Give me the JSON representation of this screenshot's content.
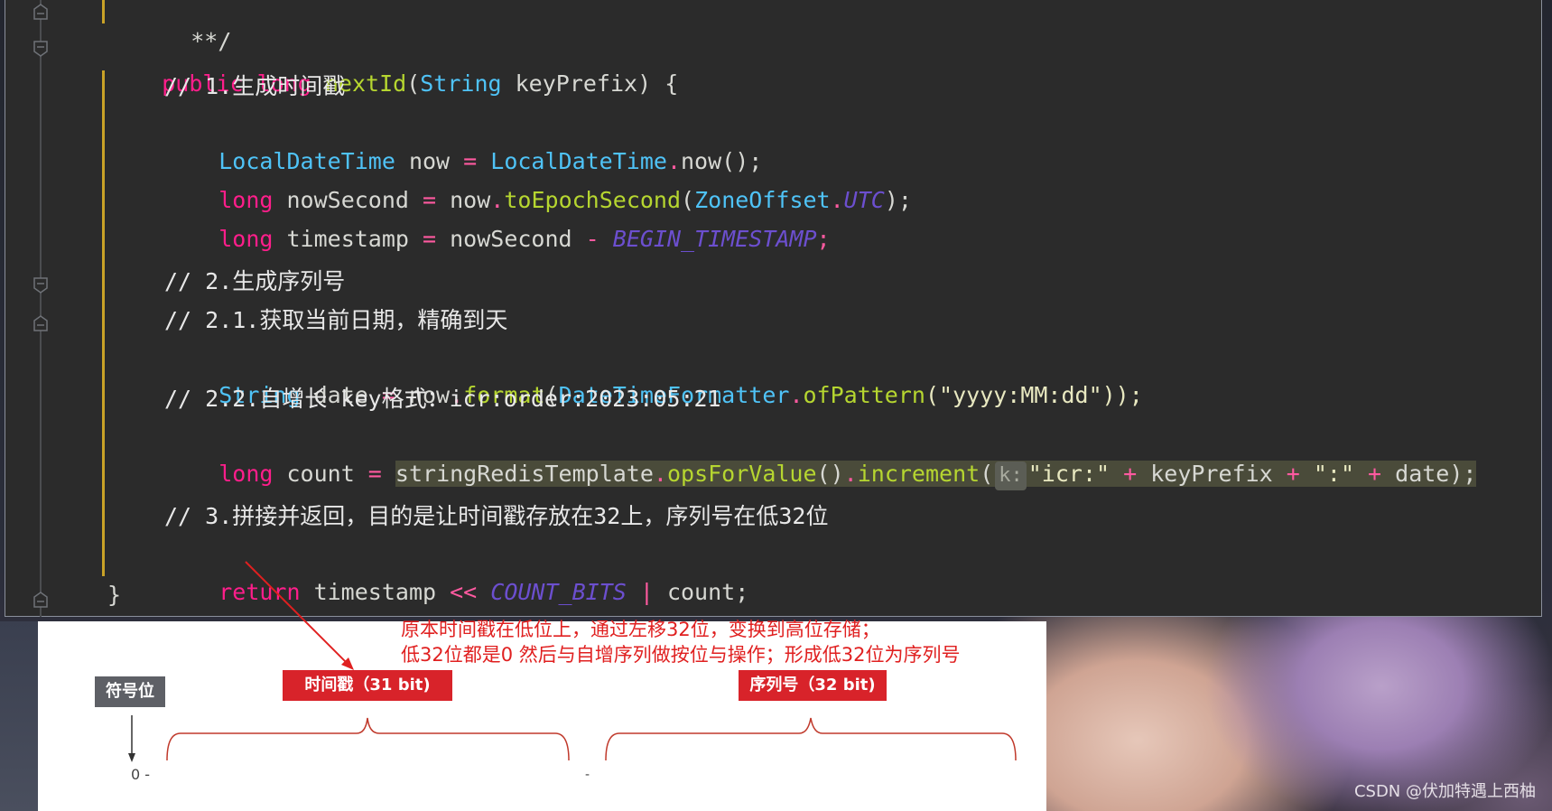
{
  "code": {
    "top_comment": "**/",
    "method_signature": {
      "kw_public": "public",
      "kw_long": "long",
      "name": "nextId",
      "paren_open": "(",
      "param_type": "String",
      "param_name": "keyPrefix",
      "paren_close": ") {"
    },
    "comment_1": "// 1.生成时间戳",
    "line_now": {
      "type1": "LocalDateTime",
      "var": " now ",
      "eq": "=",
      "type2": " LocalDateTime",
      "dot": ".",
      "call": "now();"
    },
    "line_nowSecond": {
      "kw": "long",
      "var": " nowSecond ",
      "eq": "=",
      "obj": " now",
      "dot": ".",
      "fn": "toEpochSecond",
      "p1": "(",
      "type": "ZoneOffset",
      "dot2": ".",
      "const": "UTC",
      "p2": ");"
    },
    "line_timestamp": {
      "kw": "long",
      "var": " timestamp ",
      "eq": "=",
      "obj": " nowSecond ",
      "op": "-",
      "const": " BEGIN_TIMESTAMP",
      "end": ";"
    },
    "comment_2": "// 2.生成序列号",
    "comment_2_1": "// 2.1.获取当前日期，精确到天",
    "line_date": {
      "type": "String",
      "var": " date ",
      "eq": "=",
      "obj": " now",
      "dot": ".",
      "fn": "format",
      "p1": "(",
      "type2": "DateTimeFormatter",
      "dot2": ".",
      "fn2": "ofPattern",
      "str": "(\"yyyy:MM:dd\"));"
    },
    "comment_2_2": "// 2.2.自增长 key格式：icr:order:2023:05:21",
    "line_count": {
      "kw": "long",
      "var": " count ",
      "eq": "=",
      "obj": "stringRedisTemplate",
      "dot": ".",
      "fn": "opsForValue",
      "p1": "()",
      "dot2": ".",
      "fn2": "increment",
      "p2": "(",
      "hint": "k:",
      "s1": "\"icr:\"",
      "plus1": " + ",
      "v1": "keyPrefix",
      "plus2": " + ",
      "s2": "\":\"",
      "plus3": " + ",
      "v2": "date",
      "p3": ");"
    },
    "comment_3": "// 3.拼接并返回，目的是让时间戳存放在32上，序列号在低32位",
    "line_return": {
      "kw": "return",
      "var": " timestamp ",
      "op": "<<",
      "const": " COUNT_BITS ",
      "pipe": "|",
      "end": " count;"
    },
    "closing_brace": "}"
  },
  "diagram": {
    "annotation_line1": "原本时间戳在低位上，通过左移32位，变换到高位存储；",
    "annotation_line2": "低32位都是0 然后与自增序列做按位与操作；形成低32位为序列号",
    "sign_bit_label": "符号位",
    "timestamp_label": "时间戳（31 bit)",
    "sequence_label": "序列号（32 bit)",
    "zero_label": "0 -",
    "dash": "-",
    "colors": {
      "red": "#d8232a",
      "gray": "#5e6066",
      "annotation": "#e02020"
    }
  },
  "watermark": "CSDN @伏加特遇上西柚"
}
